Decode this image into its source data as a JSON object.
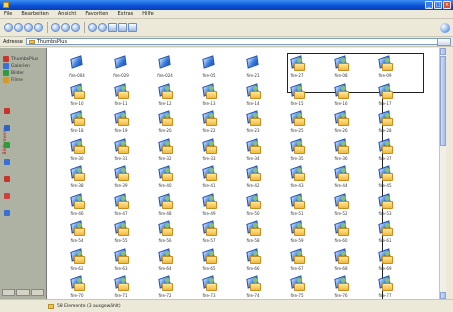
{
  "menu": [
    "File",
    "Bearbeiten",
    "Ansicht",
    "Favoriten",
    "Extras",
    "Hilfe"
  ],
  "address": {
    "label": "Adresse",
    "value": "ThumbsPlus"
  },
  "sidebar": {
    "items": [
      {
        "label": "ThumbsPlus",
        "color": "#c9342a"
      },
      {
        "label": "Galerien",
        "color": "#3a6fd8"
      },
      {
        "label": "Bilder",
        "color": "#2e9b3d"
      },
      {
        "label": "Filme",
        "color": "#d89a1c"
      }
    ],
    "caption": "Bildbrowser"
  },
  "thumbnails": [
    "fire-004",
    "fire-029",
    "fire-024",
    "fire-05",
    "fire-21",
    "fire-27",
    "fire-08",
    "fire-09",
    "fire-10",
    "fire-11",
    "fire-12",
    "fire-13",
    "fire-14",
    "fire-15",
    "fire-16",
    "fire-17",
    "fire-18",
    "fire-19",
    "fire-20",
    "fire-22",
    "fire-23",
    "fire-25",
    "fire-26",
    "fire-28",
    "fire-30",
    "fire-31",
    "fire-32",
    "fire-33",
    "fire-34",
    "fire-35",
    "fire-36",
    "fire-37",
    "fire-38",
    "fire-39",
    "fire-40",
    "fire-41",
    "fire-42",
    "fire-43",
    "fire-44",
    "fire-45",
    "fire-46",
    "fire-47",
    "fire-48",
    "fire-49",
    "fire-50",
    "fire-51",
    "fire-52",
    "fire-53",
    "fire-54",
    "fire-55",
    "fire-56",
    "fire-57",
    "fire-58",
    "fire-59",
    "fire-60",
    "fire-61",
    "fire-62",
    "fire-63",
    "fire-64",
    "fire-65",
    "fire-66",
    "fire-67",
    "fire-68",
    "fire-69",
    "fire-70",
    "fire-71",
    "fire-72",
    "fire-73",
    "fire-74",
    "fire-75",
    "fire-76",
    "fire-77"
  ],
  "status": "58 Elemente (3 ausgewählt)"
}
